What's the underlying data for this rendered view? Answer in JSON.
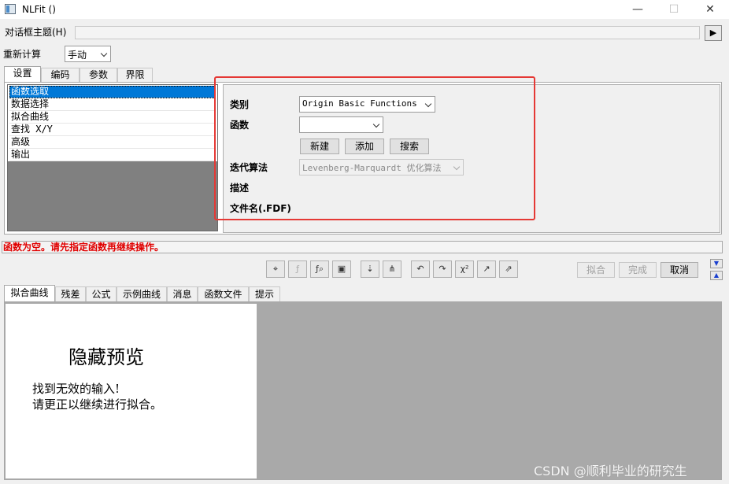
{
  "window": {
    "title": "NLFit ()",
    "minimize": "—",
    "maximize": "☐",
    "close": "✕"
  },
  "theme": {
    "label": "对话框主题(H)",
    "value": "",
    "arrow": "▶"
  },
  "recalc": {
    "label": "重新计算",
    "value": "手动"
  },
  "tabs": [
    {
      "label": "设置"
    },
    {
      "label": "编码"
    },
    {
      "label": "参数"
    },
    {
      "label": "界限"
    }
  ],
  "tree": [
    {
      "label": "函数选取"
    },
    {
      "label": "数据选择"
    },
    {
      "label": "拟合曲线"
    },
    {
      "label": "查找 X/Y"
    },
    {
      "label": "高级"
    },
    {
      "label": "输出"
    }
  ],
  "form": {
    "category_label": "类别",
    "category_value": "Origin Basic Functions",
    "function_label": "函数",
    "function_value": "",
    "btn_new": "新建",
    "btn_add": "添加",
    "btn_search": "搜索",
    "iter_label": "迭代算法",
    "iter_value": "Levenberg-Marquardt 优化算法",
    "desc_label": "描述",
    "file_label": "文件名(.FDF)"
  },
  "status": {
    "message": "函数为空。请先指定函数再继续操作。",
    "color": "#e00000"
  },
  "toolbar_icons": [
    "fit-preview-icon",
    "fit-weights-icon",
    "fit-function-icon",
    "save-icon",
    "sort-icon",
    "tree-icon",
    "undo-icon",
    "redo-icon",
    "chi-square-icon",
    "one-iteration-icon",
    "fit-until-converged-icon"
  ],
  "actions": {
    "fit": "拟合",
    "done": "完成",
    "cancel": "取消"
  },
  "bottom_tabs": [
    {
      "label": "拟合曲线"
    },
    {
      "label": "残差"
    },
    {
      "label": "公式"
    },
    {
      "label": "示例曲线"
    },
    {
      "label": "消息"
    },
    {
      "label": "函数文件"
    },
    {
      "label": "提示"
    }
  ],
  "preview": {
    "title": "隐藏预览",
    "line1": "找到无效的输入!",
    "line2": "请更正以继续进行拟合。"
  },
  "watermark": "CSDN @顺利毕业的研究生",
  "colors": {
    "highlight": "#e53935",
    "select": "#0078d7",
    "gray_panel": "#a9a9a9"
  }
}
